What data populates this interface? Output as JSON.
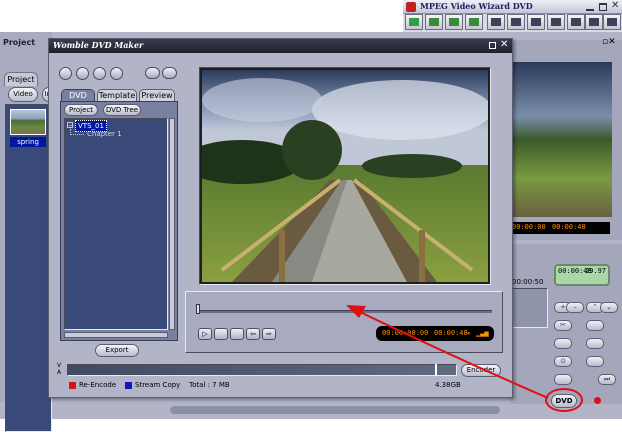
{
  "colors": {
    "bg": "#b2b4c8",
    "title_dark": "#2a2a3c",
    "accent_red": "#e01010",
    "selection": "#0018a0",
    "lcd_text": "#ff9000",
    "reencode": "#d81010",
    "streamcopy": "#1414c8"
  },
  "main_window": {
    "title": "MPEG Video Wizard DVD",
    "project_panel": {
      "title": "Project",
      "tab": "Project",
      "btn_video": "Video",
      "btn_cut": "Im",
      "thumb_label": "spring"
    },
    "right_lcd": {
      "time1": "00:00:00",
      "time2": "00:00:48"
    },
    "green_lcd": {
      "left": "00:00:48",
      "right": "29.97"
    },
    "timeline_ruler": "00:00:50",
    "dvd_button": "DVD"
  },
  "dvd_maker": {
    "title": "Womble DVD Maker",
    "tabs": [
      "DVD",
      "Template",
      "Preview"
    ],
    "btn_project": "Project",
    "btn_dvd_tree": "DVD Tree",
    "tree": {
      "root": "VTS_01",
      "child": "Chapter 1"
    },
    "btn_export": "Export",
    "timecode_current": "00:00:00:00",
    "timecode_total": "00:00:48",
    "va_label_v": "V",
    "va_label_a": "A",
    "btn_encoder": "Encoder",
    "legend_reencode": "Re-Encode",
    "legend_streamcopy": "Stream Copy",
    "total": "Total : 7 MB",
    "capacity": "4.38GB"
  }
}
